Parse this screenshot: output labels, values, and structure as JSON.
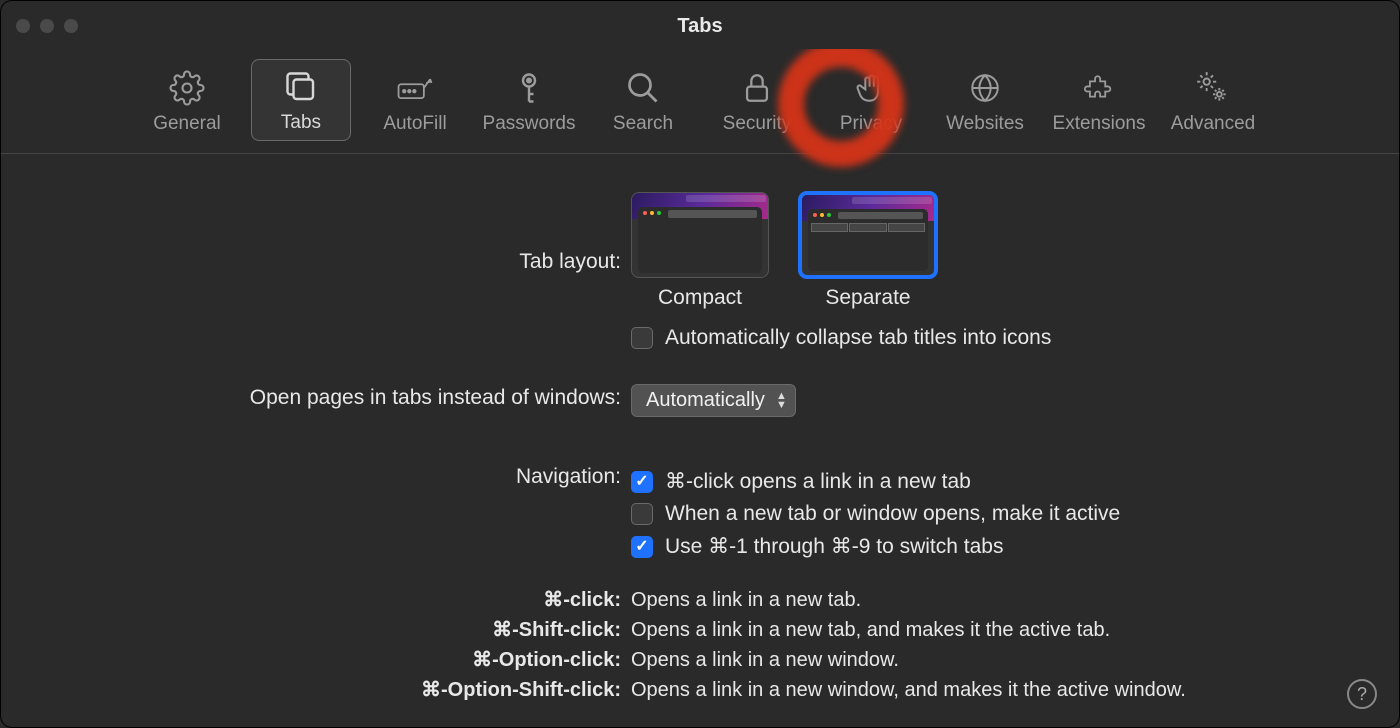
{
  "window": {
    "title": "Tabs"
  },
  "toolbar": {
    "items": [
      {
        "id": "general",
        "label": "General"
      },
      {
        "id": "tabs",
        "label": "Tabs"
      },
      {
        "id": "autofill",
        "label": "AutoFill"
      },
      {
        "id": "passwords",
        "label": "Passwords"
      },
      {
        "id": "search",
        "label": "Search"
      },
      {
        "id": "security",
        "label": "Security"
      },
      {
        "id": "privacy",
        "label": "Privacy"
      },
      {
        "id": "websites",
        "label": "Websites"
      },
      {
        "id": "extensions",
        "label": "Extensions"
      },
      {
        "id": "advanced",
        "label": "Advanced"
      }
    ],
    "selected": "tabs"
  },
  "tabLayout": {
    "label": "Tab layout:",
    "options": {
      "compact": "Compact",
      "separate": "Separate"
    },
    "selected": "separate",
    "collapseCheckbox": {
      "label": "Automatically collapse tab titles into icons",
      "checked": false
    }
  },
  "openPages": {
    "label": "Open pages in tabs instead of windows:",
    "value": "Automatically"
  },
  "navigation": {
    "label": "Navigation:",
    "items": [
      {
        "label": "⌘-click opens a link in a new tab",
        "checked": true
      },
      {
        "label": "When a new tab or window opens, make it active",
        "checked": false
      },
      {
        "label": "Use ⌘-1 through ⌘-9 to switch tabs",
        "checked": true
      }
    ]
  },
  "shortcuts": [
    {
      "key": "⌘-click:",
      "desc": "Opens a link in a new tab."
    },
    {
      "key": "⌘-Shift-click:",
      "desc": "Opens a link in a new tab, and makes it the active tab."
    },
    {
      "key": "⌘-Option-click:",
      "desc": "Opens a link in a new window."
    },
    {
      "key": "⌘-Option-Shift-click:",
      "desc": "Opens a link in a new window, and makes it the active window."
    }
  ],
  "help": "?"
}
